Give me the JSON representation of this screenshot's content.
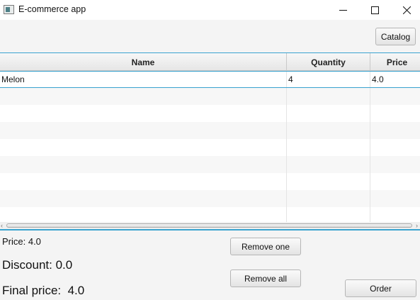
{
  "window": {
    "title": "E-commerce app",
    "controls": [
      "minimize-icon",
      "maximize-icon",
      "close-icon"
    ]
  },
  "toolbar": {
    "catalog_label": "Catalog"
  },
  "table": {
    "columns": [
      "Name",
      "Quantity",
      "Price"
    ],
    "rows": [
      {
        "name": "Melon",
        "quantity": "4",
        "price": "4.0"
      }
    ]
  },
  "summary": {
    "price_text": "Price: 4.0",
    "discount_text": "Discount: 0.0",
    "final_price_text": "Final price:  4.0"
  },
  "actions": {
    "remove_one_label": "Remove one",
    "remove_all_label": "Remove all",
    "order_label": "Order"
  },
  "colors": {
    "accent": "#3aa3cf",
    "background": "#f4f4f4"
  }
}
